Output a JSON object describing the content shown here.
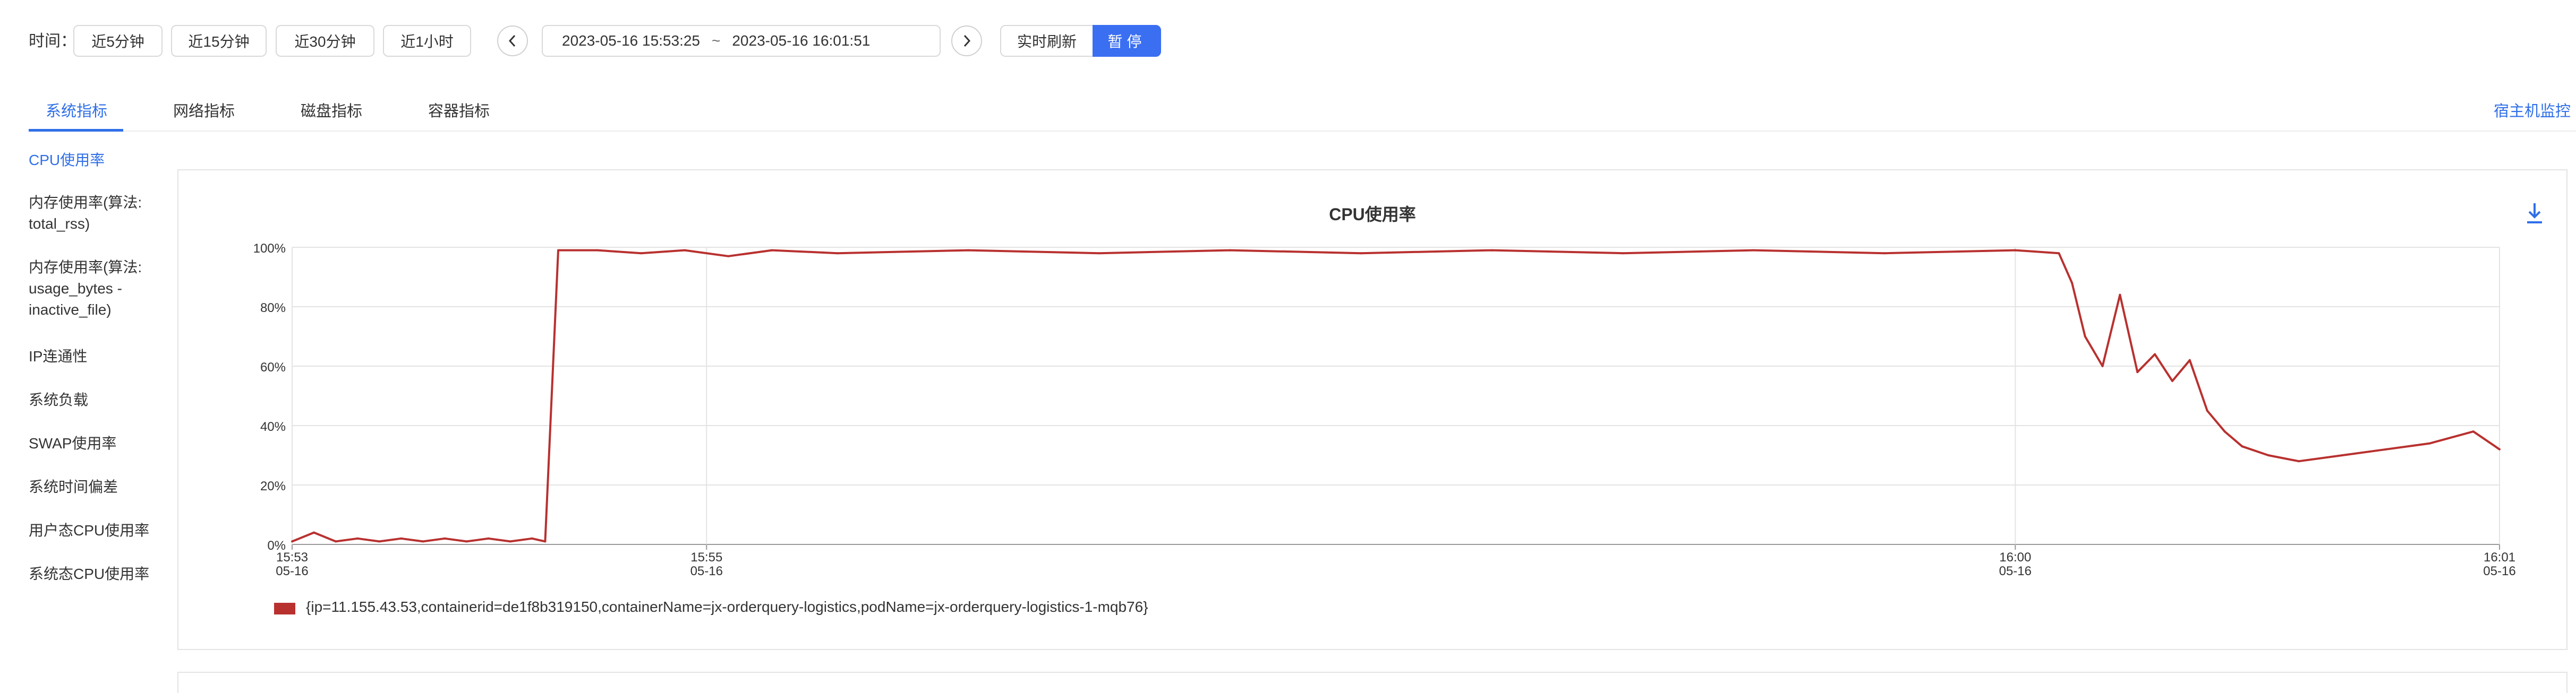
{
  "toolbar": {
    "time_label": "时间：",
    "quick_ranges": [
      "近5分钟",
      "近15分钟",
      "近30分钟",
      "近1小时"
    ],
    "range_start": "2023-05-16 15:53:25",
    "range_sep": "~",
    "range_end": "2023-05-16 16:01:51",
    "realtime_label": "实时刷新",
    "pause_label": "暂停"
  },
  "tabs": [
    {
      "label": "系统指标",
      "active": true
    },
    {
      "label": "网络指标",
      "active": false
    },
    {
      "label": "磁盘指标",
      "active": false
    },
    {
      "label": "容器指标",
      "active": false
    }
  ],
  "host_monitor_link": "宿主机监控",
  "sidebar": {
    "items": [
      {
        "label": "CPU使用率",
        "active": true
      },
      {
        "label": "内存使用率(算法:\ntotal_rss)",
        "active": false
      },
      {
        "label": "内存使用率(算法:\nusage_bytes -\ninactive_file)",
        "active": false
      },
      {
        "label": "IP连通性",
        "active": false
      },
      {
        "label": "系统负载",
        "active": false
      },
      {
        "label": "SWAP使用率",
        "active": false
      },
      {
        "label": "系统时间偏差",
        "active": false
      },
      {
        "label": "用户态CPU使用率",
        "active": false
      },
      {
        "label": "系统态CPU使用率",
        "active": false
      }
    ]
  },
  "icons": {
    "prev": "chevron-left-icon",
    "next": "chevron-right-icon",
    "download": "download-icon"
  },
  "colors": {
    "accent": "#2f6fe8",
    "series": "#b8312f"
  },
  "chart_data": {
    "type": "line",
    "title": "CPU使用率",
    "xlabel": "",
    "ylabel": "",
    "x_ticks": [
      {
        "time": "15:53",
        "date": "05-16"
      },
      {
        "time": "15:55",
        "date": "05-16"
      },
      {
        "time": "16:00",
        "date": "05-16"
      },
      {
        "time": "16:01",
        "date": "05-16"
      }
    ],
    "y_ticks": [
      "0%",
      "20%",
      "40%",
      "60%",
      "80%",
      "100%"
    ],
    "ylim": [
      0,
      100
    ],
    "x_range": [
      "15:53:25",
      "16:01:51"
    ],
    "grid": true,
    "legend_position": "bottom-left",
    "series": [
      {
        "name": "{ip=11.155.43.53,containerid=de1f8b319150,containerName=jx-orderquery-logistics,podName=jx-orderquery-logistics-1-mqb76}",
        "color": "#b8312f",
        "points": [
          [
            "15:53:25",
            1
          ],
          [
            "15:53:30",
            4
          ],
          [
            "15:53:35",
            1
          ],
          [
            "15:53:40",
            2
          ],
          [
            "15:53:45",
            1
          ],
          [
            "15:53:50",
            2
          ],
          [
            "15:53:55",
            1
          ],
          [
            "15:54:00",
            2
          ],
          [
            "15:54:05",
            1
          ],
          [
            "15:54:10",
            2
          ],
          [
            "15:54:15",
            1
          ],
          [
            "15:54:20",
            2
          ],
          [
            "15:54:23",
            1
          ],
          [
            "15:54:26",
            99
          ],
          [
            "15:54:35",
            99
          ],
          [
            "15:54:45",
            98
          ],
          [
            "15:54:55",
            99
          ],
          [
            "15:55:05",
            97
          ],
          [
            "15:55:15",
            99
          ],
          [
            "15:55:30",
            98
          ],
          [
            "15:56:00",
            99
          ],
          [
            "15:56:30",
            98
          ],
          [
            "15:57:00",
            99
          ],
          [
            "15:57:30",
            98
          ],
          [
            "15:58:00",
            99
          ],
          [
            "15:58:30",
            98
          ],
          [
            "15:59:00",
            99
          ],
          [
            "15:59:30",
            98
          ],
          [
            "16:00:00",
            99
          ],
          [
            "16:00:10",
            98
          ],
          [
            "16:00:13",
            88
          ],
          [
            "16:00:16",
            70
          ],
          [
            "16:00:20",
            60
          ],
          [
            "16:00:24",
            84
          ],
          [
            "16:00:28",
            58
          ],
          [
            "16:00:32",
            64
          ],
          [
            "16:00:36",
            55
          ],
          [
            "16:00:40",
            62
          ],
          [
            "16:00:44",
            45
          ],
          [
            "16:00:48",
            38
          ],
          [
            "16:00:52",
            33
          ],
          [
            "16:00:58",
            30
          ],
          [
            "16:01:05",
            28
          ],
          [
            "16:01:15",
            30
          ],
          [
            "16:01:25",
            32
          ],
          [
            "16:01:35",
            34
          ],
          [
            "16:01:45",
            38
          ],
          [
            "16:01:51",
            32
          ]
        ]
      }
    ]
  }
}
